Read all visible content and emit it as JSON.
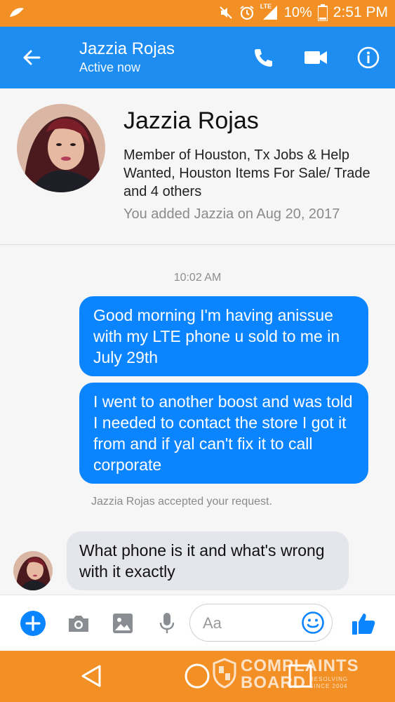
{
  "status_bar": {
    "battery_percent": "10%",
    "time": "2:51 PM",
    "network_label": "LTE"
  },
  "header": {
    "contact_name": "Jazzia Rojas",
    "presence": "Active now",
    "icons": [
      "arrow-back-icon",
      "phone-icon",
      "video-camera-icon",
      "info-icon"
    ]
  },
  "profile": {
    "name": "Jazzia Rojas",
    "description": "Member of Houston, Tx Jobs & Help Wanted, Houston Items For Sale/ Trade and 4 others",
    "added_note": "You added Jazzia on Aug 20, 2017"
  },
  "conversation": {
    "timestamp": "10:02 AM",
    "messages": [
      {
        "direction": "outgoing",
        "text": "Good morning I'm having anissue with my LTE phone u sold to me in July 29th"
      },
      {
        "direction": "outgoing",
        "text": "I went to another boost and was told I needed to contact  the store I got it from and if yal can't fix it to call corporate"
      },
      {
        "direction": "incoming",
        "text": "What phone is it and what's wrong with it exactly"
      }
    ],
    "system_note": "Jazzia Rojas accepted your request."
  },
  "composer": {
    "placeholder": "Aa",
    "value": "",
    "icons": [
      "plus-icon",
      "camera-icon",
      "image-icon",
      "microphone-icon",
      "emoji-icon",
      "thumbs-up-icon"
    ]
  },
  "watermark": {
    "line1": "COMPLAINTS",
    "line2": "BOARD",
    "tag1": "RESOLVING",
    "tag2": "SINCE 2004"
  },
  "colors": {
    "status_bar": "#f39025",
    "app_bar": "#1d8df2",
    "outgoing_bubble": "#0a84ff",
    "incoming_bubble": "#e4e6eb",
    "nav_bar": "#f39025"
  }
}
